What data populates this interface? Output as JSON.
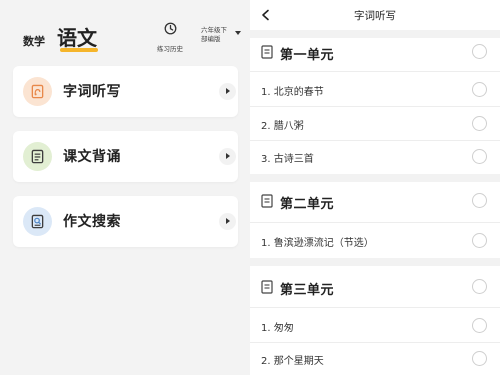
{
  "left": {
    "subjects": [
      {
        "label": "数学",
        "active": false
      },
      {
        "label": "语文",
        "active": true
      }
    ],
    "history": {
      "label": "练习历史",
      "icon": "clock-icon"
    },
    "grade": {
      "line1": "六年级下",
      "line2": "部编版"
    },
    "accent_color": "#f5b52b",
    "cards": [
      {
        "label": "字词听写",
        "icon": "dictation-icon",
        "icon_bg": "#fbe4d2",
        "icon_color": "#e8884a"
      },
      {
        "label": "课文背诵",
        "icon": "recitation-book-icon",
        "icon_bg": "#e2efd3",
        "icon_color": "#6aa44a"
      },
      {
        "label": "作文搜索",
        "icon": "essay-search-icon",
        "icon_bg": "#dbe8f7",
        "icon_color": "#4d84c4"
      }
    ]
  },
  "right": {
    "title": "字词听写",
    "units": [
      {
        "title": "第一单元",
        "lessons": [
          "1. 北京的春节",
          "2. 腊八粥",
          "3. 古诗三首"
        ]
      },
      {
        "title": "第二单元",
        "lessons": [
          "1. 鲁滨逊漂流记（节选）"
        ]
      },
      {
        "title": "第三单元",
        "lessons": [
          "1. 匆匆",
          "2. 那个星期天"
        ]
      }
    ]
  }
}
